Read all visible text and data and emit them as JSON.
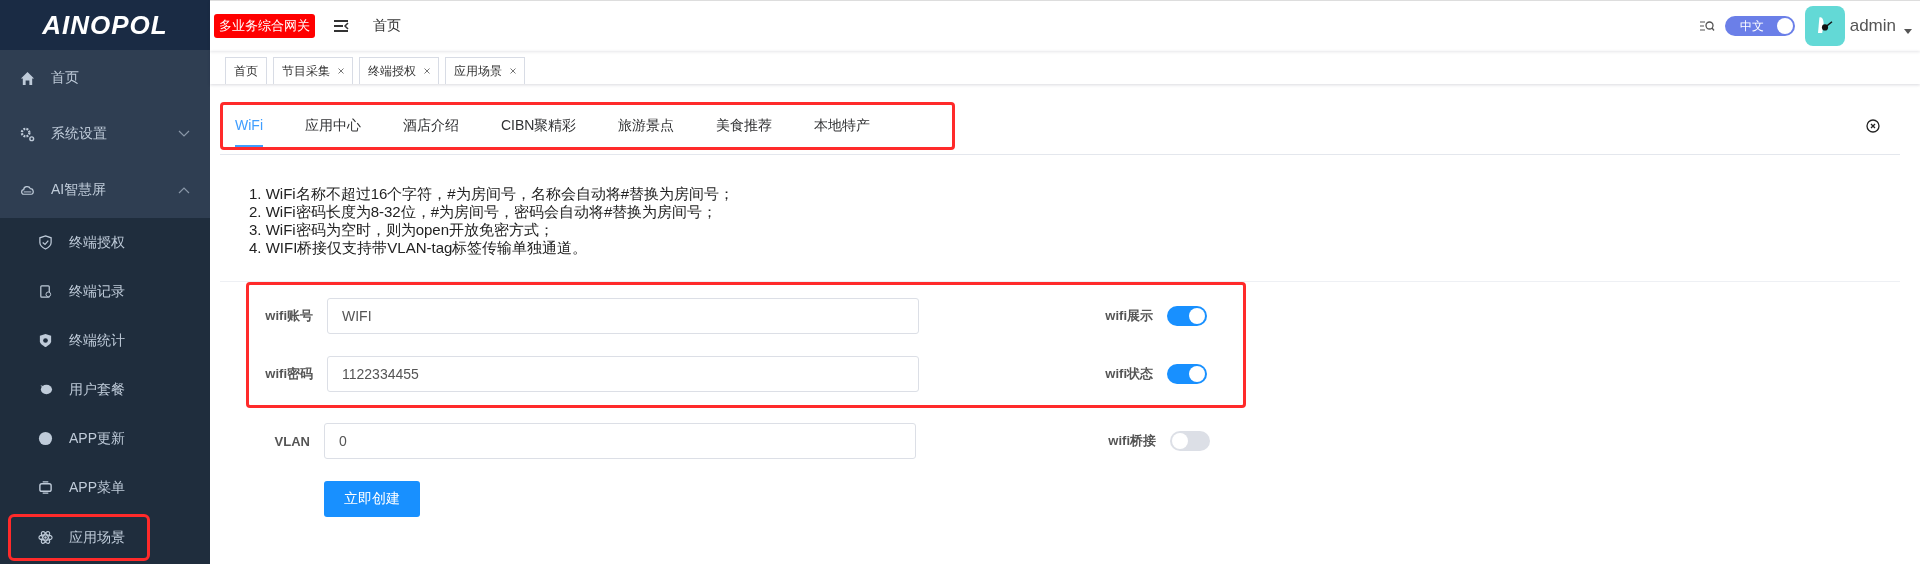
{
  "sidebar": {
    "logo": "AINOPOL",
    "items": [
      {
        "label": "首页",
        "kind": "home"
      },
      {
        "label": "系统设置",
        "kind": "gears",
        "expanded": false
      },
      {
        "label": "AI智慧屏",
        "kind": "cloud",
        "expanded": true,
        "children": [
          {
            "label": "终端授权",
            "kind": "shield",
            "highlighted": false
          },
          {
            "label": "终端记录",
            "kind": "clipboard",
            "highlighted": false
          },
          {
            "label": "终端统计",
            "kind": "badge",
            "highlighted": false
          },
          {
            "label": "用户套餐",
            "kind": "bubble",
            "highlighted": false
          },
          {
            "label": "APP更新",
            "kind": "dot",
            "highlighted": false
          },
          {
            "label": "APP菜单",
            "kind": "app",
            "highlighted": false
          },
          {
            "label": "应用场景",
            "kind": "atom",
            "highlighted": true
          }
        ]
      }
    ]
  },
  "header": {
    "badge": "多业务综合网关",
    "breadcrumb": "首页",
    "language": {
      "label": "中文",
      "on": true
    },
    "user": "admin"
  },
  "tags": [
    {
      "label": "首页",
      "closable": false
    },
    {
      "label": "节目采集",
      "closable": true
    },
    {
      "label": "终端授权",
      "closable": true
    },
    {
      "label": "应用场景",
      "closable": true
    }
  ],
  "tabs": {
    "highlighted": true,
    "items": [
      {
        "label": "WiFi",
        "selected": true
      },
      {
        "label": "应用中心",
        "selected": false
      },
      {
        "label": "酒店介绍",
        "selected": false
      },
      {
        "label": "CIBN聚精彩",
        "selected": false
      },
      {
        "label": "旅游景点",
        "selected": false
      },
      {
        "label": "美食推荐",
        "selected": false
      },
      {
        "label": "本地特产",
        "selected": false
      }
    ]
  },
  "notes": [
    "1. WiFi名称不超过16个字符，#为房间号，名称会自动将#替换为房间号；",
    "2. WiFi密码长度为8-32位，#为房间号，密码会自动将#替换为房间号；",
    "3. WiFi密码为空时，则为open开放免密方式；",
    "4. WIFI桥接仅支持带VLAN-tag标签传输单独通道。"
  ],
  "form": {
    "rows": [
      {
        "label": "wifi账号",
        "value": "WIFI",
        "switch_label": "wifi展示",
        "on": true,
        "highlighted": true
      },
      {
        "label": "wifi密码",
        "value": "1122334455",
        "switch_label": "wifi状态",
        "on": true,
        "highlighted": true
      },
      {
        "label": "VLAN",
        "value": "0",
        "switch_label": "wifi桥接",
        "on": false,
        "highlighted": false
      }
    ],
    "submit": "立即创建"
  }
}
